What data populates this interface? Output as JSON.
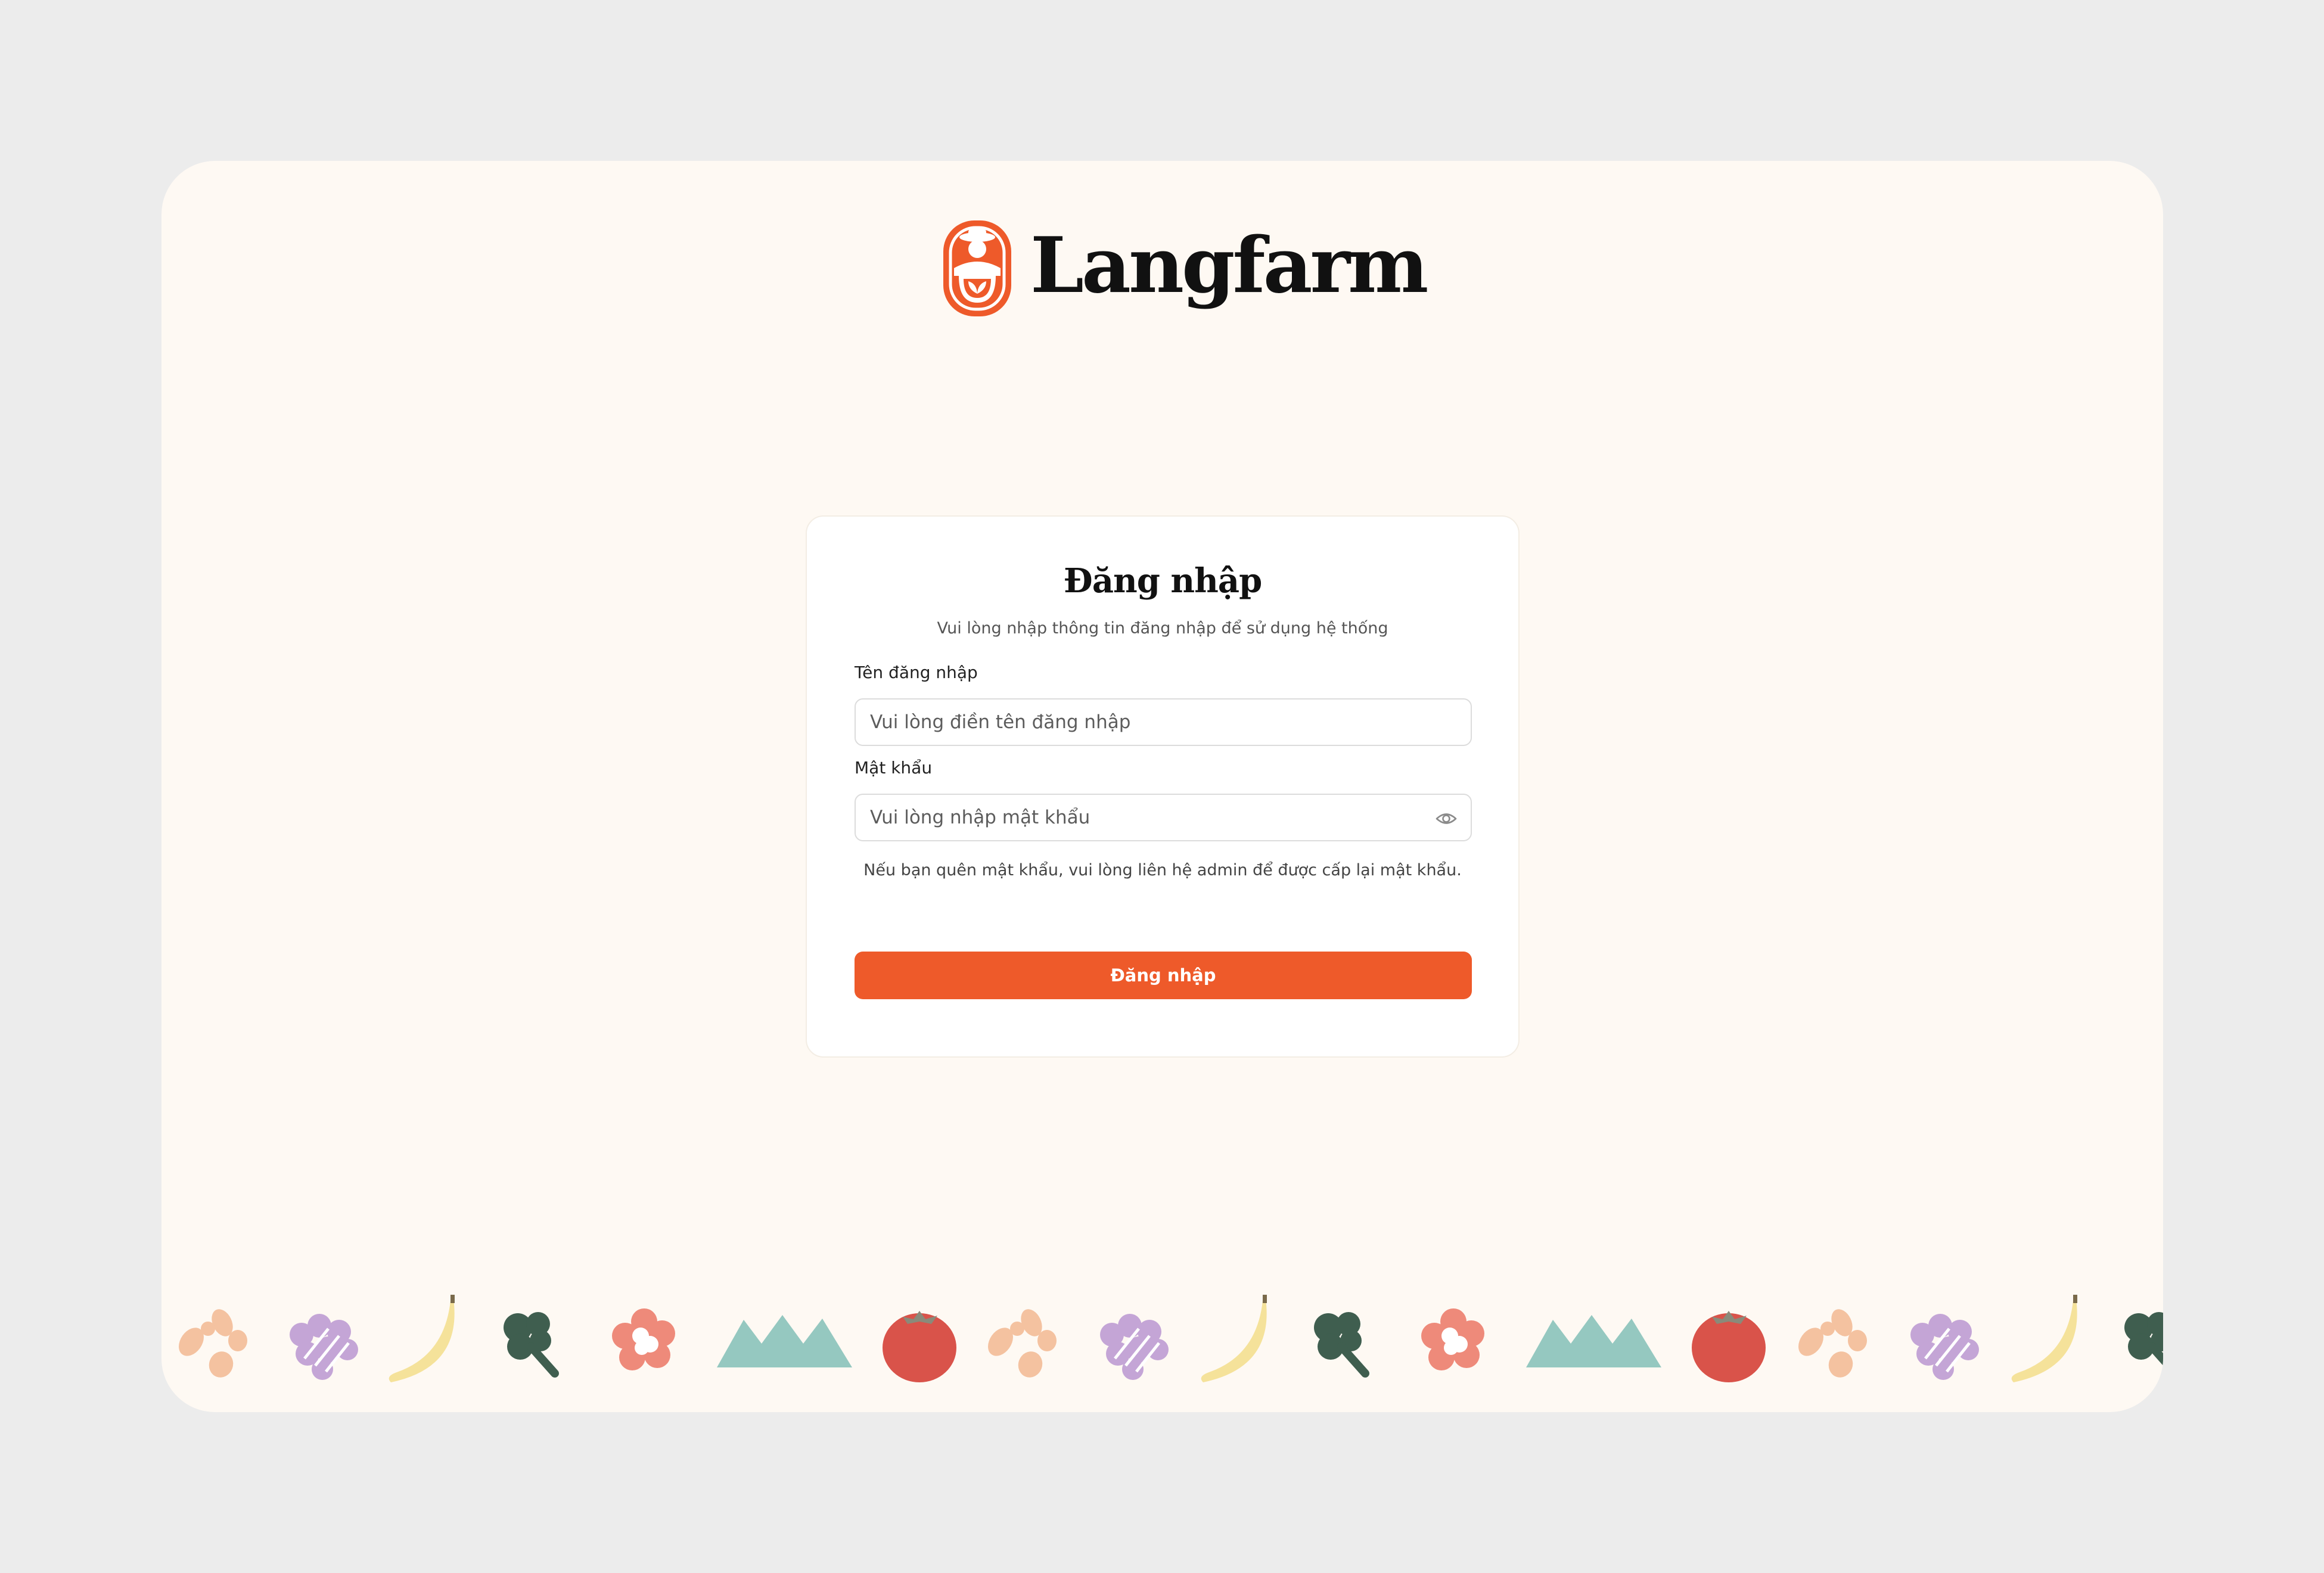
{
  "brand": {
    "name": "Langfarm",
    "color": "#ee5a2a"
  },
  "login": {
    "title": "Đăng nhập",
    "subtitle": "Vui lòng nhập thông tin đăng nhập để sử dụng hệ thống",
    "username_label": "Tên đăng nhập",
    "username_placeholder": "Vui lòng điền tên đăng nhập",
    "password_label": "Mật khẩu",
    "password_placeholder": "Vui lòng nhập mật khẩu",
    "password_toggle_icon": "eye-icon",
    "hint": "Nếu bạn quên mật khẩu, vui lòng liên hệ admin để được cấp lại mật khẩu.",
    "submit_label": "Đăng nhập"
  },
  "decoration": {
    "items": [
      "peanuts",
      "grapes",
      "banana",
      "broccoli",
      "flower",
      "mountains",
      "tomato",
      "peanuts",
      "grapes",
      "banana",
      "broccoli",
      "flower",
      "mountains",
      "tomato",
      "peanuts",
      "grapes",
      "banana",
      "broccoli"
    ]
  }
}
